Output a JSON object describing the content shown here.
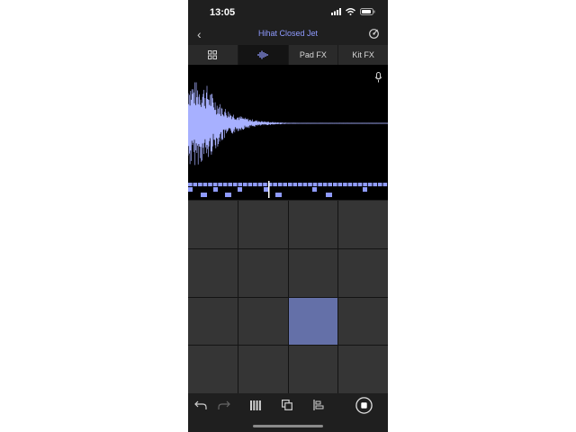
{
  "status": {
    "time": "13:05"
  },
  "header": {
    "back_label": "‹",
    "title": "Hihat Closed Jet"
  },
  "tabs": [
    {
      "label": "",
      "icon": "grid-icon"
    },
    {
      "label": "",
      "icon": "waveform-icon"
    },
    {
      "label": "Pad FX"
    },
    {
      "label": "Kit FX"
    }
  ],
  "colors": {
    "accent": "#8f9bff",
    "pad_active": "#6470a8",
    "pad": "#353535",
    "background": "#1f1f1f"
  },
  "pads": {
    "rows": 4,
    "cols": 4,
    "active_index": 10
  },
  "toolbar": [
    "undo-icon",
    "redo-icon",
    "pattern-icon",
    "duplicate-icon",
    "clip-icon",
    "record-stop-icon"
  ]
}
